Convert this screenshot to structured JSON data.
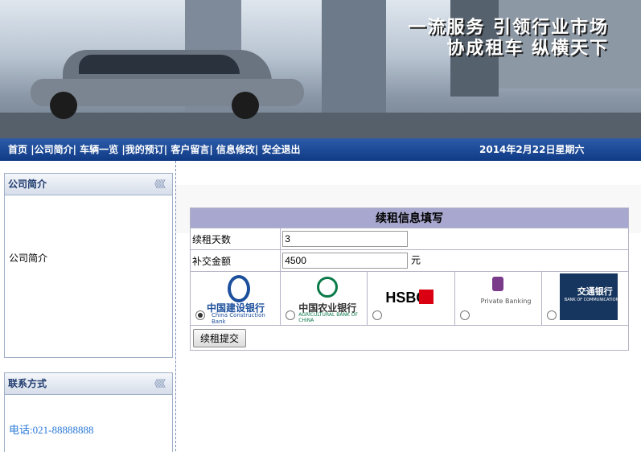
{
  "banner": {
    "slogan_line1": "一流服务 引领行业市场",
    "slogan_line2": "协成租车 纵横天下"
  },
  "nav": {
    "links": [
      "首页",
      "|公司简介|",
      "车辆一览",
      "|我的预订|",
      "客户留言|",
      "信息修改|",
      "安全退出"
    ],
    "date": "2014年2月22日星期六"
  },
  "sidebar": {
    "company": {
      "title": "公司简介",
      "arrows": "《《《",
      "body": "公司简介"
    },
    "contact": {
      "title": "联系方式",
      "arrows": "《《《",
      "phone": "电话:021-88888888"
    }
  },
  "form": {
    "title": "续租信息填写",
    "days_label": "续租天数",
    "days_value": "3",
    "amount_label": "补交金额",
    "amount_value": "4500",
    "amount_unit": "元",
    "banks": [
      {
        "name_cn": "中国建设银行",
        "name_en": "China Construction Bank",
        "selected": true
      },
      {
        "name_cn": "中国农业银行",
        "name_en": "AGRICULTURAL BANK OF CHINA",
        "selected": false
      },
      {
        "name_cn": "HSBC",
        "name_en": "",
        "selected": false
      },
      {
        "name_cn": "Private Banking",
        "name_en": "",
        "selected": false
      },
      {
        "name_cn": "交通银行",
        "name_en": "BANK OF COMMUNICATIONS",
        "selected": false
      }
    ],
    "submit_label": "续租提交"
  },
  "colors": {
    "nav_bg": "#1a4690",
    "form_title_bg": "#a7a7cf",
    "ccb": "#1c4f9c",
    "abc": "#0b7a4a",
    "hsbc": "#db0011",
    "comm": "#17365f"
  }
}
